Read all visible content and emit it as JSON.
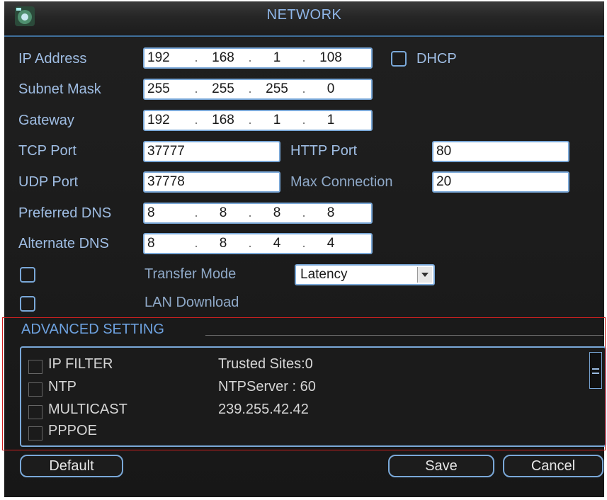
{
  "window": {
    "title": "NETWORK"
  },
  "fields": {
    "ip_address": {
      "label": "IP Address",
      "octets": [
        "192",
        "168",
        "1",
        "108"
      ]
    },
    "dhcp": {
      "label": "DHCP",
      "checked": false
    },
    "subnet_mask": {
      "label": "Subnet Mask",
      "octets": [
        "255",
        "255",
        "255",
        "0"
      ]
    },
    "gateway": {
      "label": "Gateway",
      "octets": [
        "192",
        "168",
        "1",
        "1"
      ]
    },
    "tcp_port": {
      "label": "TCP Port",
      "value": "37777"
    },
    "http_port": {
      "label": "HTTP Port",
      "value": "80"
    },
    "udp_port": {
      "label": "UDP Port",
      "value": "37778"
    },
    "max_connection": {
      "label": "Max Connection",
      "value": "20"
    },
    "preferred_dns": {
      "label": "Preferred DNS",
      "octets": [
        "8",
        "8",
        "8",
        "8"
      ]
    },
    "alternate_dns": {
      "label": "Alternate DNS",
      "octets": [
        "8",
        "8",
        "4",
        "4"
      ]
    },
    "transfer_mode": {
      "label": "Transfer Mode",
      "value": "Latency",
      "checked": false
    },
    "lan_download": {
      "label": "LAN Download",
      "checked": false
    }
  },
  "advanced": {
    "title": "ADVANCED SETTING",
    "rows": [
      {
        "name": "IP FILTER",
        "value": "Trusted Sites:0"
      },
      {
        "name": "NTP",
        "value": "NTPServer : 60"
      },
      {
        "name": "MULTICAST",
        "value": "239.255.42.42"
      },
      {
        "name": "PPPOE",
        "value": ""
      }
    ]
  },
  "buttons": {
    "default": "Default",
    "save": "Save",
    "cancel": "Cancel"
  },
  "colors": {
    "accent": "#7aa8d8",
    "label": "#9fbde3",
    "background": "#1a1a1a",
    "highlight_box": "#d02020"
  }
}
